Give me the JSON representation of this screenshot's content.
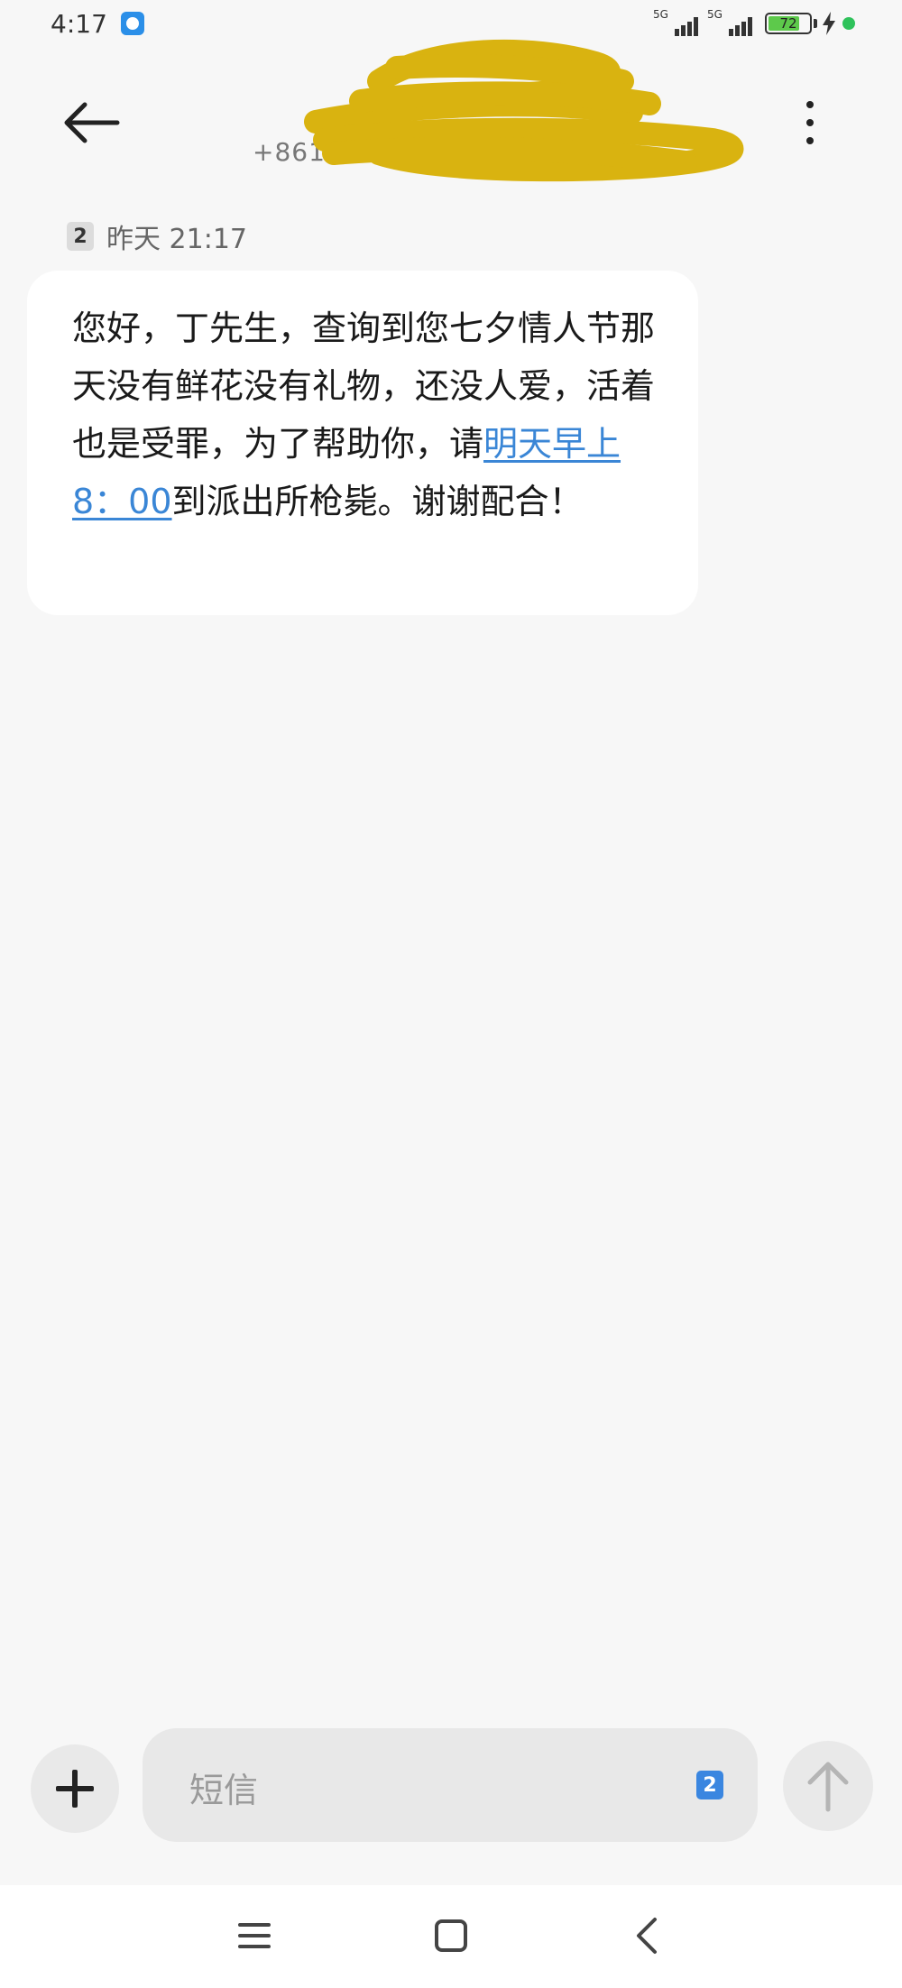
{
  "status_bar": {
    "time": "4:17",
    "network_1": "5G",
    "network_2": "5G",
    "battery_percent": "72",
    "app_icon": "notification-app-icon",
    "charging_icon": "lightning-icon"
  },
  "header": {
    "contact_visible_prefix": "+861",
    "back_icon": "arrow-left-icon",
    "menu_icon": "more-vertical-icon"
  },
  "thread": {
    "sim_slot": "2",
    "date_label": "昨天 21:17",
    "message": {
      "part_before_link": "您好，丁先生，查询到您七夕情人节那天没有鲜花没有礼物，还没人爱，活着也是受罪，为了帮助你，请",
      "link_text": "明天早上8：00",
      "part_after_link": "到派出所枪毙。谢谢配合！"
    }
  },
  "compose": {
    "placeholder": "短信",
    "sim_slot": "2",
    "add_icon": "plus-icon",
    "send_icon": "arrow-up-icon"
  },
  "nav_bar": {
    "menu_icon": "hamburger-icon",
    "home_icon": "square-home-icon",
    "back_icon": "chevron-left-icon"
  },
  "colors": {
    "background": "#f7f7f7",
    "bubble": "#ffffff",
    "link": "#3a86d6",
    "redaction": "#d9b310",
    "sim_badge_blue": "#3a86e0",
    "battery_green": "#5dc94b"
  }
}
